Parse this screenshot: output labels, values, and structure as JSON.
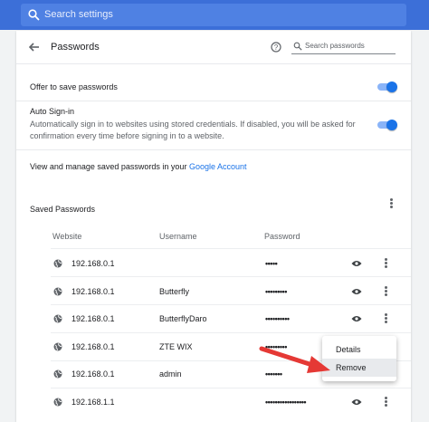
{
  "search_settings": {
    "placeholder": "Search settings"
  },
  "header": {
    "title": "Passwords",
    "search_placeholder": "Search passwords"
  },
  "offer_save": {
    "label": "Offer to save passwords",
    "enabled": true
  },
  "auto_signin": {
    "title": "Auto Sign-in",
    "description_line1": "Automatically sign in to websites using stored credentials. If disabled, you will be asked for",
    "description_line2": "confirmation every time before signing in to a website.",
    "enabled": true
  },
  "manage": {
    "text": "View and manage saved passwords in your",
    "link": "Google Account"
  },
  "saved": {
    "title": "Saved Passwords",
    "columns": {
      "website": "Website",
      "username": "Username",
      "password": "Password"
    },
    "rows": [
      {
        "website": "192.168.0.1",
        "username": "",
        "password": "•••••"
      },
      {
        "website": "192.168.0.1",
        "username": "Butterfly",
        "password": "•••••••••"
      },
      {
        "website": "192.168.0.1",
        "username": "ButterflyDaro",
        "password": "••••••••••"
      },
      {
        "website": "192.168.0.1",
        "username": "ZTE WIX",
        "password": "•••••••••"
      },
      {
        "website": "192.168.0.1",
        "username": "admin",
        "password": "•••••••"
      },
      {
        "website": "192.168.1.1",
        "username": "",
        "password": "•••••••••••••••••"
      }
    ]
  },
  "context_menu": {
    "items": [
      "Details",
      "Remove"
    ],
    "highlighted": "Remove"
  },
  "colors": {
    "accent": "#1a73e8",
    "topbar": "#3c6fd8",
    "arrow": "#e53935"
  }
}
